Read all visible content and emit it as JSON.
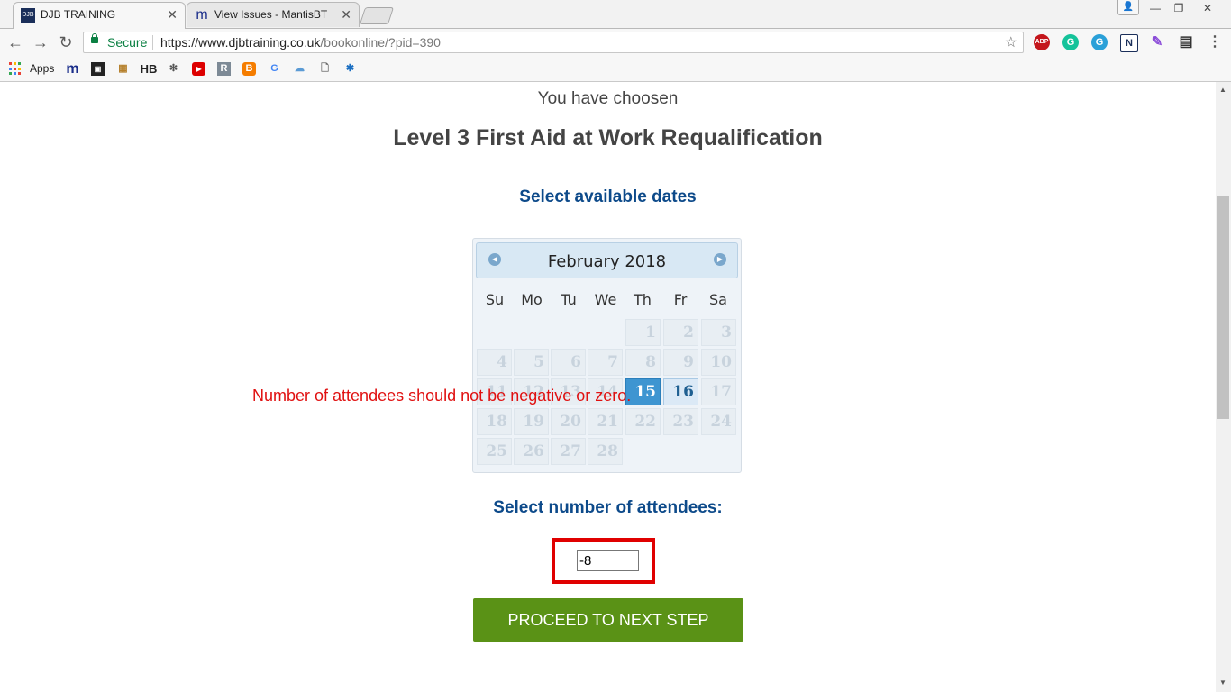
{
  "browser": {
    "tabs": [
      {
        "title": "DJB TRAINING",
        "favicon": "DJB",
        "active": true
      },
      {
        "title": "View Issues - MantisBT",
        "favicon": "m",
        "active": false
      }
    ],
    "address": {
      "secure_label": "Secure",
      "url_host": "https://www.djbtraining.co.uk",
      "url_path": "/bookonline/?pid=390"
    },
    "bookmarks_apps_label": "Apps",
    "bookmark_icons": [
      "mantis-icon",
      "box-icon",
      "package-icon",
      "hb-icon",
      "snowflake-icon",
      "youtube-icon",
      "r-icon",
      "blogger-icon",
      "google-icon",
      "cloud-icon",
      "page-icon",
      "puzzle-icon"
    ],
    "extensions": [
      "ABP",
      "G",
      "G",
      "N",
      "✎",
      "▤"
    ]
  },
  "page": {
    "chosen_label": "You have choosen",
    "course_title": "Level 3 First Aid at Work Requalification",
    "dates_title": "Select available dates",
    "calendar": {
      "month_label": "February 2018",
      "weekdays": [
        "Su",
        "Mo",
        "Tu",
        "We",
        "Th",
        "Fr",
        "Sa"
      ],
      "first_weekday_index": 4,
      "days_in_month": 28,
      "available_days": [
        15,
        16
      ],
      "selected_day": 15
    },
    "error_message": "Number of attendees should not be negative or zero.",
    "attendees_title": "Select number of attendees:",
    "attendees_value": "-8",
    "proceed_label": "PROCEED TO NEXT STEP",
    "colors": {
      "heading_blue": "#0d4a8a",
      "error_red": "#e01010",
      "button_green": "#5a9216",
      "selected_day_blue": "#3e95d1"
    }
  }
}
